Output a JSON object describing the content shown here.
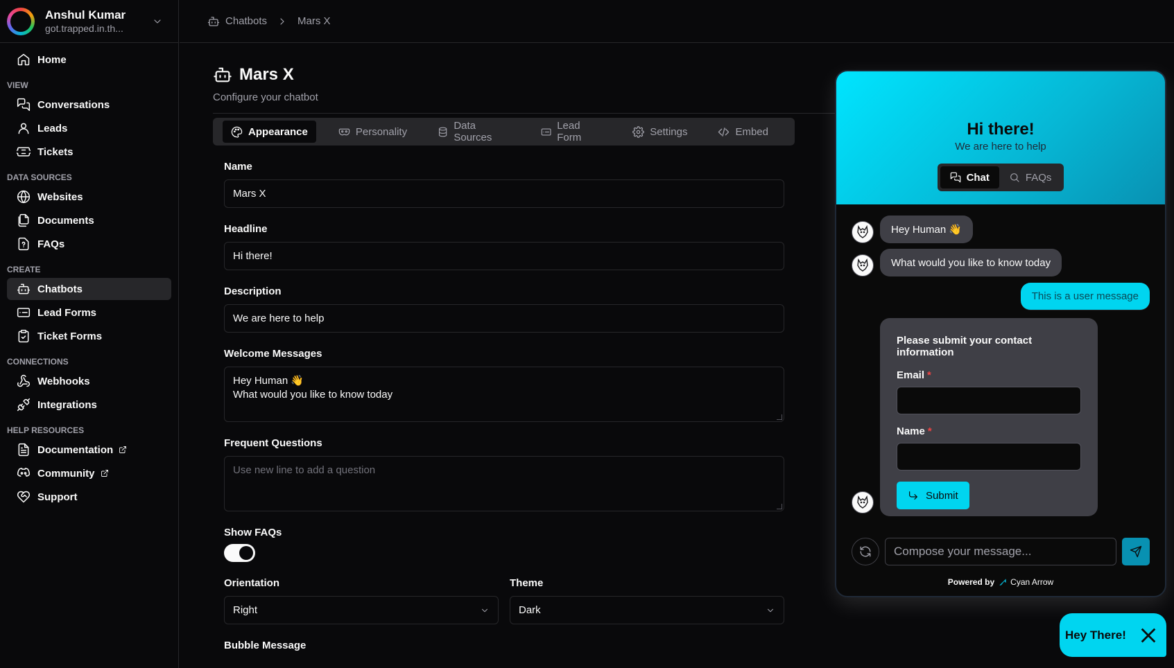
{
  "user": {
    "name": "Anshul Kumar",
    "email": "got.trapped.in.th..."
  },
  "sidebar": {
    "home": "Home",
    "sections": {
      "view": "VIEW",
      "data_sources": "DATA SOURCES",
      "create": "CREATE",
      "connections": "CONNECTIONS",
      "help": "HELP RESOURCES"
    },
    "items": {
      "conversations": "Conversations",
      "leads": "Leads",
      "tickets": "Tickets",
      "websites": "Websites",
      "documents": "Documents",
      "faqs": "FAQs",
      "chatbots": "Chatbots",
      "lead_forms": "Lead Forms",
      "ticket_forms": "Ticket Forms",
      "webhooks": "Webhooks",
      "integrations": "Integrations",
      "documentation": "Documentation",
      "community": "Community",
      "support": "Support"
    },
    "active": "chatbots"
  },
  "breadcrumb": {
    "parent": "Chatbots",
    "current": "Mars X"
  },
  "page": {
    "title": "Mars X",
    "subtitle": "Configure your chatbot"
  },
  "tabs": [
    {
      "label": "Appearance",
      "icon": "palette-icon",
      "active": true
    },
    {
      "label": "Personality",
      "icon": "mask-icon"
    },
    {
      "label": "Data Sources",
      "icon": "database-icon"
    },
    {
      "label": "Lead Form",
      "icon": "form-icon"
    },
    {
      "label": "Settings",
      "icon": "gear-icon"
    },
    {
      "label": "Embed",
      "icon": "code-icon"
    }
  ],
  "form": {
    "name": {
      "label": "Name",
      "value": "Mars X"
    },
    "headline": {
      "label": "Headline",
      "value": "Hi there!"
    },
    "description": {
      "label": "Description",
      "value": "We are here to help"
    },
    "welcome": {
      "label": "Welcome Messages",
      "line1": "Hey Human 👋",
      "line2": "What would you like to know today"
    },
    "questions": {
      "label": "Frequent Questions",
      "placeholder": "Use new line to add a question"
    },
    "show_faqs": {
      "label": "Show FAQs",
      "on": true
    },
    "orientation": {
      "label": "Orientation",
      "value": "Right"
    },
    "theme": {
      "label": "Theme",
      "value": "Dark"
    },
    "bubble_message": {
      "label": "Bubble Message"
    }
  },
  "widget": {
    "title": "Hi there!",
    "subtitle": "We are here to help",
    "tab_chat": "Chat",
    "tab_faqs": "FAQs",
    "messages": {
      "m1": "Hey Human 👋",
      "m2": "What would you like to know today",
      "user": "This is a user message"
    },
    "contact": {
      "title": "Please submit your contact information",
      "email_label": "Email",
      "name_label": "Name",
      "required": "*",
      "submit": "Submit"
    },
    "composer_placeholder": "Compose your message...",
    "powered_by": "Powered by",
    "brand": "Cyan Arrow",
    "accent": "#00d5f0"
  },
  "bubble": {
    "label": "Hey There!"
  }
}
